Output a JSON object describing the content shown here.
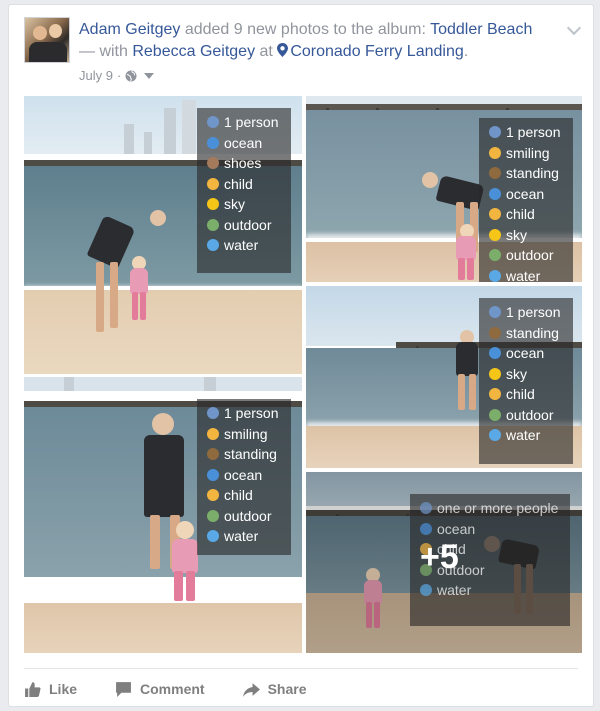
{
  "post": {
    "author": "Adam Geitgey",
    "action_text": " added 9 new photos to the album: ",
    "album": "Toddler Beach",
    "with_text": "— with ",
    "tagged": "Rebecca Geitgey",
    "at_text": " at ",
    "place": "Coronado Ferry Landing",
    "period": ".",
    "date": "July 9",
    "separator": " · "
  },
  "icons": {
    "avatar": "profile-photo",
    "options": "chevron-down-icon",
    "privacy": "globe-icon",
    "location": "map-pin-icon"
  },
  "photos": [
    {
      "tags": [
        "1 person",
        "ocean",
        "shoes",
        "child",
        "sky",
        "outdoor",
        "water"
      ]
    },
    {
      "tags": [
        "1 person",
        "smiling",
        "standing",
        "ocean",
        "child",
        "sky",
        "outdoor",
        "water"
      ]
    },
    {
      "tags": [
        "1 person",
        "standing",
        "ocean",
        "sky",
        "child",
        "outdoor",
        "water"
      ]
    },
    {
      "tags": [
        "1 person",
        "smiling",
        "standing",
        "ocean",
        "child",
        "outdoor",
        "water"
      ]
    },
    {
      "tags": [
        "one or more people",
        "ocean",
        "child",
        "outdoor",
        "water"
      ],
      "more": "+5"
    }
  ],
  "tag_icons": {
    "person": "person-icon",
    "ocean": "wave-icon",
    "shoes": "shoe-icon",
    "child": "child-face-icon",
    "sky": "sun-icon",
    "outdoor": "landscape-icon",
    "water": "droplet-icon",
    "smiling": "smile-icon",
    "standing": "standing-person-icon"
  },
  "actions": {
    "like": "Like",
    "comment": "Comment",
    "share": "Share"
  },
  "colors": {
    "link": "#365899",
    "meta": "#90949c",
    "action": "#7f7f7f",
    "card_bg": "#ffffff",
    "page_bg": "#e9ebee"
  }
}
